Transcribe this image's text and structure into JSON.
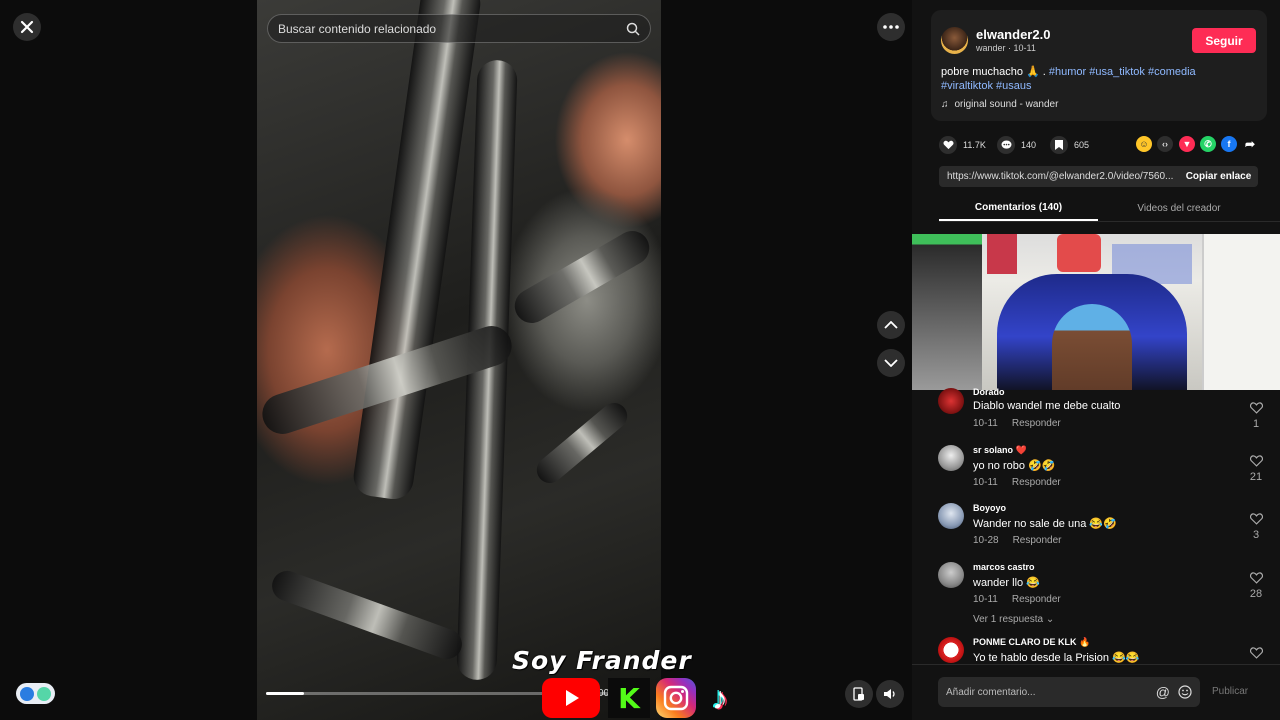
{
  "search": {
    "placeholder": "Buscar contenido relacionado"
  },
  "player": {
    "time": "00",
    "progress": 0.1,
    "overlay_title": "Soy Frander",
    "kick_letter": "K",
    "tiktok_glyph": "♪"
  },
  "author": {
    "handle": "elwander2.0",
    "subtitle": "wander · 10-11",
    "follow_label": "Seguir",
    "caption_text": "pobre muchacho 🙏 .",
    "hashtags": [
      "#humor",
      "#usa_tiktok",
      "#comedia",
      "#viraltiktok",
      "#usaus"
    ],
    "sound": "original sound - wander"
  },
  "stats": {
    "likes": "11.7K",
    "comments": "140",
    "saves": "605"
  },
  "share": {
    "link": "https://www.tiktok.com/@elwander2.0/video/7560...",
    "copy_label": "Copiar enlace"
  },
  "tabs": {
    "comments": "Comentarios (140)",
    "creator_videos": "Videos del creador"
  },
  "comments": [
    {
      "user": "Dorado",
      "text": "Diablo wandel me debe cualto",
      "date": "10-11",
      "reply": "Responder",
      "likes": "1"
    },
    {
      "user": "sr solano ❤️",
      "text": "yo no robo 🤣🤣",
      "date": "10-11",
      "reply": "Responder",
      "likes": "21"
    },
    {
      "user": "Boyoyo",
      "text": "Wander no sale de una 😂🤣",
      "date": "10-28",
      "reply": "Responder",
      "likes": "3"
    },
    {
      "user": "marcos castro",
      "text": "wander llo 😂",
      "date": "10-11",
      "reply": "Responder",
      "likes": "28",
      "replies": "Ver 1 respuesta ⌄"
    },
    {
      "user": "PONME CLARO DE KLK 🔥",
      "text": "Yo te hablo desde la Prision 😂😂"
    }
  ],
  "composer": {
    "placeholder": "Añadir comentario...",
    "at": "@",
    "publish": "Publicar"
  },
  "colors": {
    "accent": "#fe2c55",
    "hashtag": "#8fb9ff"
  }
}
